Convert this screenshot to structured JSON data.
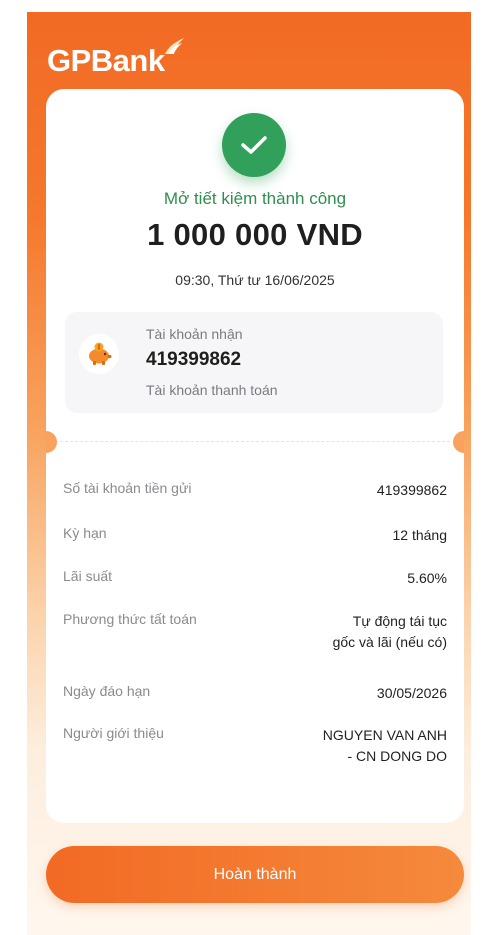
{
  "brand": {
    "logo_text": "GPBank"
  },
  "result": {
    "status": "Mở tiết kiệm thành công",
    "amount": "1 000 000 VND",
    "datetime": "09:30, Thứ tư 16/06/2025"
  },
  "receiving_account": {
    "label": "Tài khoản nhận",
    "number": "419399862",
    "type": "Tài khoản thanh toán"
  },
  "details": [
    {
      "label": "Số tài khoản tiền gửi",
      "value_lines": [
        "419399862"
      ]
    },
    {
      "label": "Kỳ hạn",
      "value_lines": [
        "12 tháng"
      ]
    },
    {
      "label": "Lãi suất",
      "value_lines": [
        "5.60%"
      ]
    },
    {
      "label": "Phương thức tất toán",
      "value_lines": [
        "Tự động tái tục",
        "gốc và lãi (nếu có)"
      ]
    },
    {
      "label": "Ngày đáo hạn",
      "value_lines": [
        "30/05/2026"
      ]
    },
    {
      "label": "Người giới thiệu",
      "value_lines": [
        "NGUYEN VAN ANH",
        "- CN DONG DO"
      ]
    }
  ],
  "actions": {
    "done_label": "Hoàn thành"
  },
  "colors": {
    "brand_orange": "#f26a24",
    "success_green": "#31a05a"
  },
  "icons": {
    "success": "check-icon",
    "account": "piggy-bank-icon"
  }
}
